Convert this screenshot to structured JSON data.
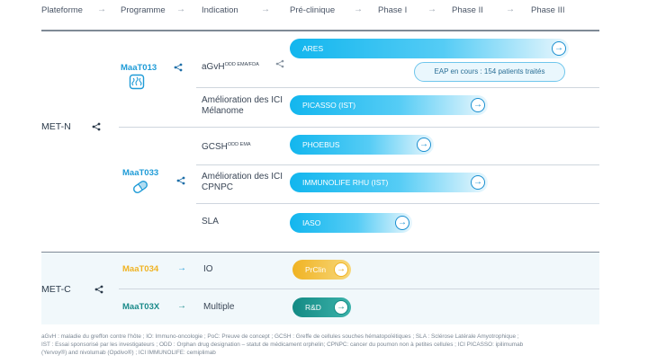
{
  "header": {
    "columns": [
      "Plateforme",
      "Programme",
      "Indication",
      "Pré-clinique",
      "Phase I",
      "Phase II",
      "Phase III"
    ],
    "arrow": "→"
  },
  "platforms": {
    "met_n": "MET-N",
    "met_c": "MET-C"
  },
  "programs": {
    "maat013": "MaaT013",
    "maat033": "MaaT033",
    "maat034": "MaaT034",
    "maat03x": "MaaT03X"
  },
  "indications": {
    "agvh": "aGvH",
    "agvh_sup": "ODD EMA/FDA",
    "ici_melanome_1": "Amélioration des ICI",
    "ici_melanome_2": "Mélanome",
    "gcsh": "GCSH",
    "gcsh_sup": "ODD EMA",
    "ici_cpnpc_1": "Amélioration des ICI",
    "ici_cpnpc_2": "CPNPC",
    "sla": "SLA",
    "io": "IO",
    "multiple": "Multiple"
  },
  "bars": {
    "ares": "ARES",
    "eap": "EAP en cours : 154 patients traités",
    "picasso": "PICASSO (IST)",
    "phoebus": "PHOEBUS",
    "immunolife": "IMMUNOLIFE RHU (IST)",
    "iaso": "IASO",
    "preclin": "PrClin",
    "rd": "R&D",
    "go_icon": "→"
  },
  "colors": {
    "accent_blue": "#12b6ee",
    "program_blue": "#1e9bd7",
    "maat034_yellow": "#f0b323",
    "maat03x_teal": "#1a8a8a"
  },
  "icons": {
    "share": "share-icon",
    "microbiome": "microbiome-icon",
    "capsule": "capsule-icon"
  },
  "footnote": {
    "line1": "aGvH : maladie du greffon contre l'hôte ; IO: Immuno-oncologie ; PoC: Preuve de concept ; GCSH : Greffe de cellules souches hématopoïétiques ; SLA : Sclérose Latérale Amyotrophique ;",
    "line2": "IST : Essai sponsorisé par les investigateurs ; ODD : Orphan drug designation – statut de médicament orphelin; CPNPC: cancer du poumon non à petites cellules ; ICI PICASSO: ipilimumab",
    "line3": "(Yervoy®) and nivolumab (Opdivo®) ; ICI IMMUNOLIFE: cemiplimab"
  }
}
